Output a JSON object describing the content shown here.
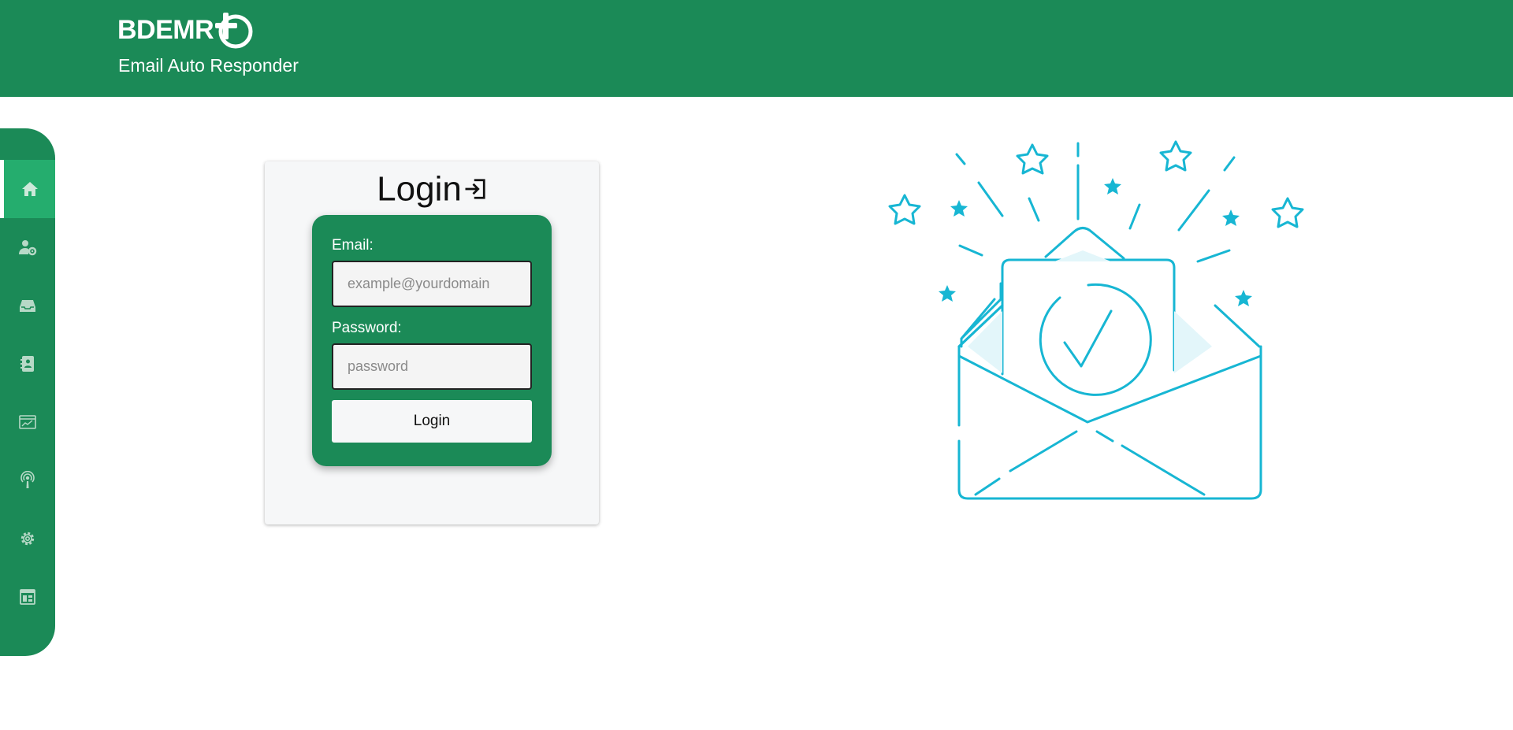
{
  "header": {
    "logo_text": "BDEMR",
    "subtitle": "Email Auto Responder",
    "color": "#1b8a57"
  },
  "sidebar": {
    "items": [
      {
        "icon": "home-icon",
        "active": true
      },
      {
        "icon": "user-settings-icon",
        "active": false
      },
      {
        "icon": "inbox-icon",
        "active": false
      },
      {
        "icon": "contacts-icon",
        "active": false
      },
      {
        "icon": "analytics-icon",
        "active": false
      },
      {
        "icon": "podcast-icon",
        "active": false
      },
      {
        "icon": "gear-icon",
        "active": false
      },
      {
        "icon": "table-icon",
        "active": false
      }
    ]
  },
  "login": {
    "title": "Login",
    "email_label": "Email:",
    "email_placeholder": "example@yourdomain",
    "password_label": "Password:",
    "password_placeholder": "password",
    "button_label": "Login"
  },
  "illustration": {
    "icon": "email-confirmed-illustration",
    "color": "#17b6d3"
  }
}
